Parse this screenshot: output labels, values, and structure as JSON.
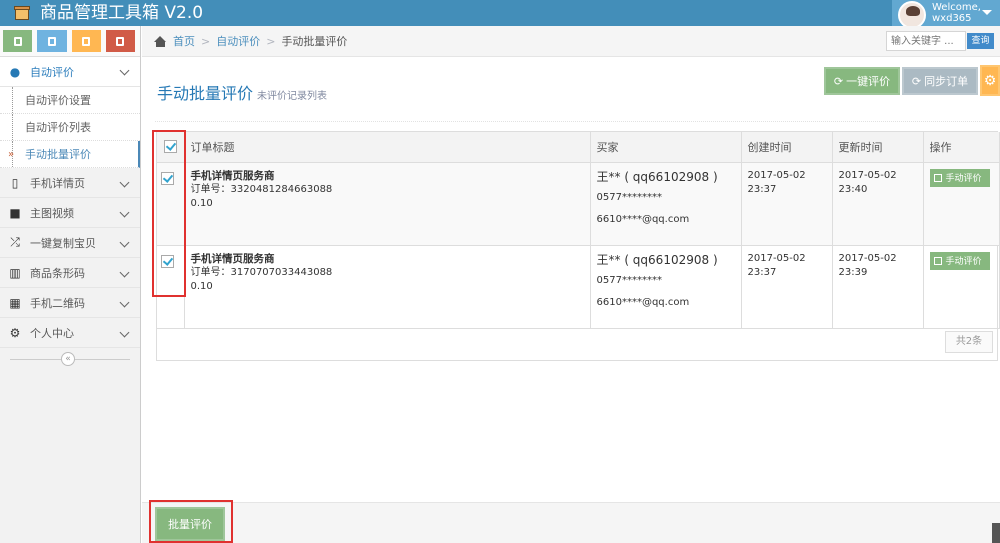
{
  "app": {
    "title": "商品管理工具箱 V2.0"
  },
  "user": {
    "welcome": "Welcome,",
    "name": "wxd365"
  },
  "sidebar": {
    "menu": [
      {
        "label": "自动评价",
        "icon": "comment-icon"
      },
      {
        "label": "手机详情页",
        "icon": "mobile-icon"
      },
      {
        "label": "主图视频",
        "icon": "video-icon"
      },
      {
        "label": "一键复制宝贝",
        "icon": "shuffle-icon"
      },
      {
        "label": "商品条形码",
        "icon": "barcode-icon"
      },
      {
        "label": "手机二维码",
        "icon": "qrcode-icon"
      },
      {
        "label": "个人中心",
        "icon": "gear-icon"
      }
    ],
    "submenu": [
      {
        "label": "自动评价设置"
      },
      {
        "label": "自动评价列表"
      },
      {
        "label": "手动批量评价"
      }
    ],
    "collapse_glyph": "«"
  },
  "breadcrumb": {
    "home": "首页",
    "level1": "自动评价",
    "current": "手动批量评价",
    "sep": ">"
  },
  "search": {
    "placeholder": "输入关键字 ...",
    "button": "查询"
  },
  "page": {
    "title": "手动批量评价",
    "subtitle": "未评价记录列表"
  },
  "toolbar": {
    "one_key": "一键评价",
    "sync": "同步订单"
  },
  "table": {
    "headers": [
      "订单标题",
      "买家",
      "创建时间",
      "更新时间",
      "操作"
    ],
    "order_no_label": "订单号：",
    "rows": [
      {
        "title": "手机详情页服务商",
        "order_no": "3320481284663088",
        "amount": "0.10",
        "buyer": "王** ( qq66102908 )",
        "phone": "0577********",
        "email": "6610****@qq.com",
        "created_date": "2017-05-02",
        "created_time": "23:37",
        "updated_date": "2017-05-02",
        "updated_time": "23:40",
        "action": "手动评价"
      },
      {
        "title": "手机详情页服务商",
        "order_no": "3170707033443088",
        "amount": "0.10",
        "buyer": "王** ( qq66102908 )",
        "phone": "0577********",
        "email": "6610****@qq.com",
        "created_date": "2017-05-02",
        "created_time": "23:37",
        "updated_date": "2017-05-02",
        "updated_time": "23:39",
        "action": "手动评价"
      }
    ],
    "total": "共2条"
  },
  "footer": {
    "batch_button": "批量评价"
  },
  "colors": {
    "navbar": "#438eb9",
    "success": "#87b87f",
    "highlight": "#e0312f"
  }
}
